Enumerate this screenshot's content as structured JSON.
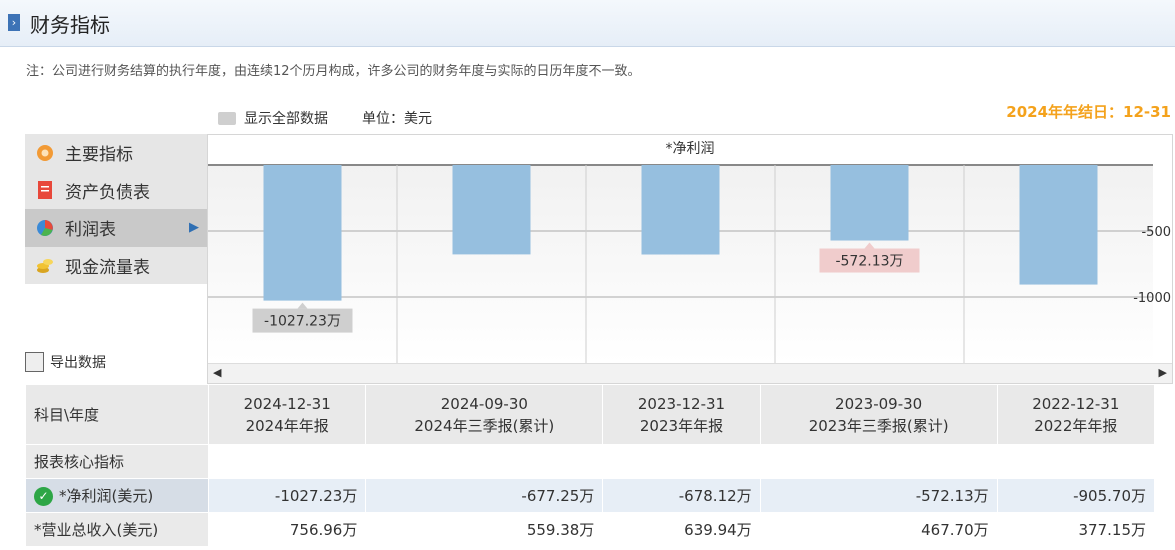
{
  "header": {
    "title": "财务指标"
  },
  "note": "注：公司进行财务结算的执行年度，由连续12个历月构成，许多公司的财务年度与实际的日历年度不一致。",
  "toolbar": {
    "show_all": "显示全部数据",
    "unit": "单位：美元"
  },
  "year_end": "2024年年结日：12-31",
  "menu": {
    "items": [
      {
        "label": "主要指标",
        "icon": "gear-flower-icon"
      },
      {
        "label": "资产负债表",
        "icon": "document-icon"
      },
      {
        "label": "利润表",
        "icon": "pie-chart-icon",
        "active": true
      },
      {
        "label": "现金流量表",
        "icon": "coins-icon"
      }
    ]
  },
  "export_label": "导出数据",
  "chart_data": {
    "type": "bar",
    "title": "*净利润",
    "categories": [
      "2024-12-31",
      "2024-09-30",
      "2023-12-31",
      "2023-09-30",
      "2022-12-31"
    ],
    "values": [
      -1027.23,
      -677.25,
      -678.12,
      -572.13,
      -905.7
    ],
    "unit": "万",
    "ylim": [
      -1500,
      0
    ],
    "yticks": [
      -500,
      -1000
    ],
    "ytick_labels": [
      "-500",
      "-1000"
    ],
    "callouts": [
      {
        "index": 0,
        "text": "-1027.23万",
        "color": "#cfcfcf"
      },
      {
        "index": 3,
        "text": "-572.13万",
        "color": "#f0cccc"
      }
    ],
    "bar_color": "#96bfdf",
    "grid": true
  },
  "table": {
    "corner": "科目\\年度",
    "columns": [
      {
        "date": "2024-12-31",
        "period": "2024年年报"
      },
      {
        "date": "2024-09-30",
        "period": "2024年三季报(累计)"
      },
      {
        "date": "2023-12-31",
        "period": "2023年年报"
      },
      {
        "date": "2023-09-30",
        "period": "2023年三季报(累计)"
      },
      {
        "date": "2022-12-31",
        "period": "2022年年报"
      }
    ],
    "section": "报表核心指标",
    "rows": [
      {
        "label": "*净利润(美元)",
        "values": [
          "-1027.23万",
          "-677.25万",
          "-678.12万",
          "-572.13万",
          "-905.70万"
        ],
        "highlight": true
      },
      {
        "label": "*营业总收入(美元)",
        "values": [
          "756.96万",
          "559.38万",
          "639.94万",
          "467.70万",
          "377.15万"
        ]
      }
    ]
  }
}
